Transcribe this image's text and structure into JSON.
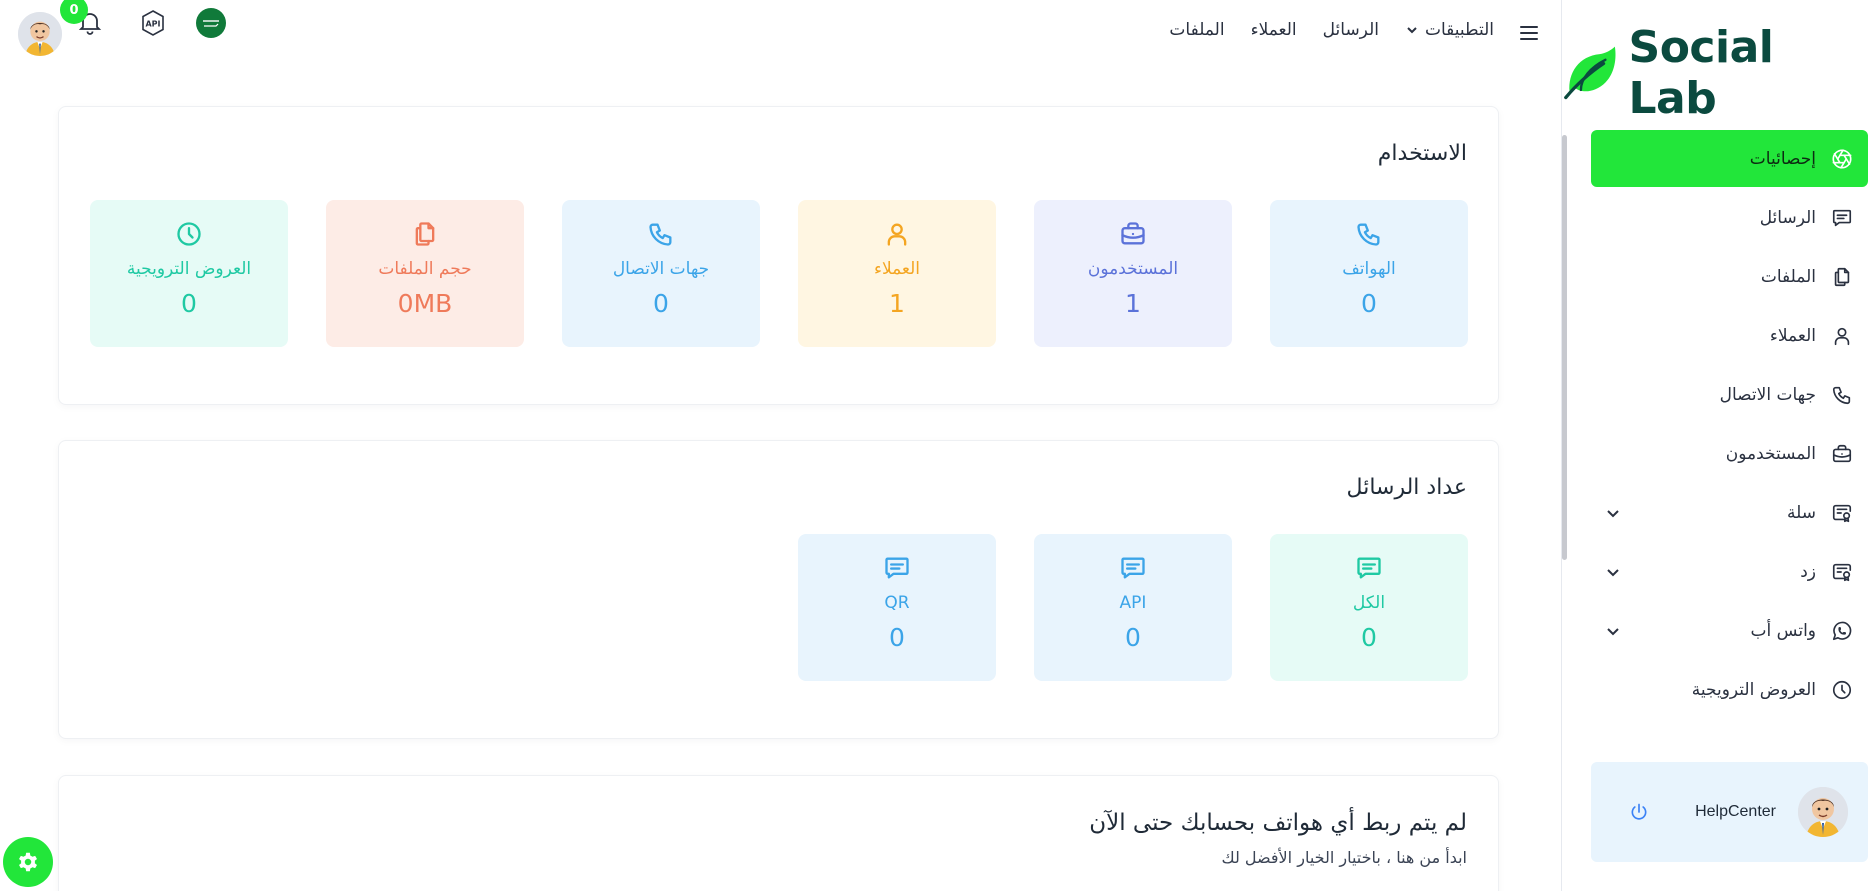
{
  "brand": {
    "name": "Social Lab",
    "color": "#0b4a3f",
    "accent": "#22e63a"
  },
  "topnav": {
    "items": [
      {
        "label": "التطبيقات",
        "has_dropdown": true
      },
      {
        "label": "الرسائل"
      },
      {
        "label": "العملاء"
      },
      {
        "label": "الملفات"
      }
    ],
    "notifications_count": "0",
    "api_icon_label": "API"
  },
  "sidebar": {
    "items": [
      {
        "label": "إحصائيات",
        "icon": "aperture-icon",
        "active": true
      },
      {
        "label": "الرسائل",
        "icon": "message-icon"
      },
      {
        "label": "الملفات",
        "icon": "files-icon"
      },
      {
        "label": "العملاء",
        "icon": "user-icon"
      },
      {
        "label": "جهات الاتصال",
        "icon": "phone-icon"
      },
      {
        "label": "المستخدمون",
        "icon": "briefcase-icon"
      },
      {
        "label": "سلة",
        "icon": "certificate-icon",
        "has_dropdown": true
      },
      {
        "label": "زد",
        "icon": "certificate-icon",
        "has_dropdown": true
      },
      {
        "label": "واتس أب",
        "icon": "whatsapp-icon",
        "has_dropdown": true
      },
      {
        "label": "العروض الترويجية",
        "icon": "clock-icon"
      }
    ],
    "help_center": {
      "label": "HelpCenter"
    }
  },
  "usage": {
    "title": "الاستخدام",
    "tiles": [
      {
        "label": "الهواتف",
        "value": "0",
        "icon": "phone-icon",
        "bg": "#e8f4fd",
        "color": "#3ba4e8"
      },
      {
        "label": "المستخدمون",
        "value": "1",
        "icon": "briefcase-icon",
        "bg": "#edf0fd",
        "color": "#5b72d9"
      },
      {
        "label": "العملاء",
        "value": "1",
        "icon": "user-icon",
        "bg": "#fff6e2",
        "color": "#f4a521"
      },
      {
        "label": "جهات الاتصال",
        "value": "0",
        "icon": "phone-icon",
        "bg": "#e8f4fd",
        "color": "#3ba4e8"
      },
      {
        "label": "حجم الملفات",
        "value": "0MB",
        "icon": "files-icon",
        "bg": "#fdece6",
        "color": "#ef7a5a"
      },
      {
        "label": "العروض الترويجية",
        "value": "0",
        "icon": "clock-icon",
        "bg": "#e6fbf6",
        "color": "#1fc9a3"
      }
    ]
  },
  "messages_counter": {
    "title": "عداد الرسائل",
    "tiles": [
      {
        "label": "الكل",
        "value": "0",
        "icon": "message-icon",
        "bg": "#e6fbf6",
        "color": "#1fc9a3"
      },
      {
        "label": "API",
        "value": "0",
        "icon": "message-icon",
        "bg": "#e8f4fd",
        "color": "#3ba4e8"
      },
      {
        "label": "QR",
        "value": "0",
        "icon": "message-icon",
        "bg": "#e8f4fd",
        "color": "#3ba4e8"
      }
    ]
  },
  "phones_notice": {
    "title": "لم يتم ربط أي هواتف بحسابك حتى الآن",
    "subtitle": "ابدأ من هنا ، باختيار الخيار الأفضل لك"
  }
}
